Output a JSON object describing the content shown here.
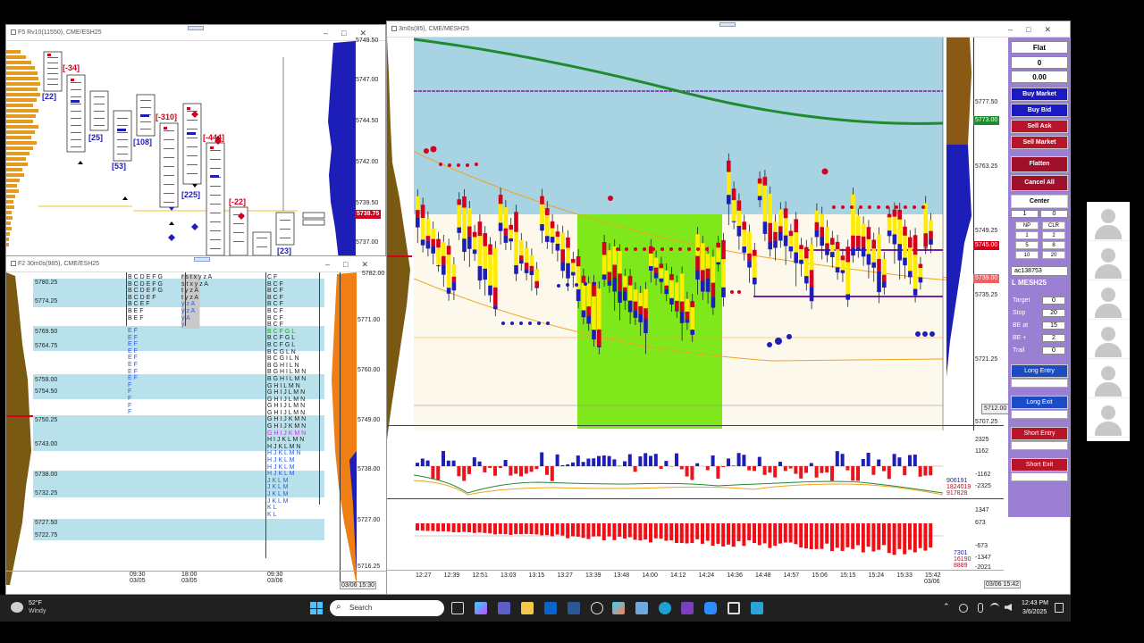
{
  "windows": {
    "topleft": {
      "title": "F5 Rv10(11550), CME/ESH25"
    },
    "bottomleft": {
      "title": "F2 30m0s(985), CME/ESH25"
    },
    "main": {
      "title": "3m0s(85), CME/MESH25"
    }
  },
  "topleft": {
    "axis": [
      "5749.50",
      "5747.00",
      "5744.50",
      "5742.00",
      "5739.50",
      "5737.00"
    ],
    "price_tag": "5738.75",
    "deltas": [
      "[-34]",
      "[22]",
      "[25]",
      "[53]",
      "[108]",
      "[-310]",
      "[225]",
      "[-444]",
      "[-22]",
      "[23]"
    ]
  },
  "bottomleft": {
    "axis": [
      "5782.00",
      "5771.00",
      "5760.00",
      "5749.00",
      "5738.00",
      "5727.00",
      "5716.25"
    ],
    "prices": [
      "5780.25",
      "5774.25",
      "5769.50",
      "5764.75",
      "5759.00",
      "5754.50",
      "5750.25",
      "5743.00",
      "5738.00",
      "5732.25",
      "5727.50",
      "5722.75"
    ],
    "dates": [
      {
        "t": "09:30",
        "d": "03/05"
      },
      {
        "t": "18:00",
        "d": "03/05"
      },
      {
        "t": "09:30",
        "d": "03/06"
      }
    ],
    "timestamp": "03/06 15:30",
    "tpo_col1": [
      "B C D E F G",
      "B C D E F G",
      "B C D E F G",
      "B C D E F",
      "B C E F",
      "B E F",
      "B E F"
    ],
    "tpo_col2": [
      "r s t x y z A",
      "s t x y z A",
      "t y z A",
      "t y z A",
      "y z A",
      "y z A",
      "y A",
      "y"
    ],
    "tpo_col3": [
      "C F",
      "B C F",
      "B C F",
      "B C F",
      "B C F",
      "B C F",
      "B C F",
      "B C F",
      "B C F G L",
      "B C F G L",
      "B C F G L",
      "B C G L N",
      "B C G I L N",
      "B G H I L N",
      "B G H I L M N",
      "B G H I L M N",
      "G H I L M N",
      "G H I J L M N",
      "G H I J L M N",
      "G H I J L M N",
      "G H I J L M N",
      "G H I J K M N",
      "G H I J K M N",
      "G H I J K M N",
      "H I J K L M N",
      "H J K L M N",
      "H J K L M N",
      "H J K L M",
      "H J K L M",
      "H J K L M",
      "J K L M",
      "J K L M",
      "J K L M",
      "J K L M",
      "K L",
      "K L"
    ]
  },
  "main": {
    "axis": [
      "5777.50",
      "5763.25",
      "5749.25",
      "5735.25",
      "5721.25",
      "5707.25"
    ],
    "tags": {
      "green": "5773.00",
      "red1": "5745.00",
      "red2": "5739.00",
      "gray": "5712.00"
    },
    "osc1_axis": [
      "2325",
      "1162",
      "-1162",
      "-2325"
    ],
    "osc1_values": [
      "906191",
      "1824019",
      "917828"
    ],
    "osc2_axis": [
      "2021",
      "1347",
      "673",
      "-673",
      "-1347",
      "-2021"
    ],
    "osc2_values": [
      "7301",
      "16190",
      "8889"
    ],
    "times": [
      "12:27",
      "12:39",
      "12:51",
      "13:03",
      "13:15",
      "13:27",
      "13:39",
      "13:48",
      "14:00",
      "14:12",
      "14:24",
      "14:36",
      "14:48",
      "14:57",
      "15:06",
      "15:15",
      "15:24",
      "15:33",
      "15:42"
    ],
    "end_date": "03/06",
    "end_stamp": "03/06 15:42"
  },
  "order_panel": {
    "status": "Flat",
    "position": "0",
    "pnl": "0.00",
    "buttons": [
      "Buy Market",
      "Buy Bid",
      "Sell Ask",
      "Sell Market",
      "Flatten",
      "Cancel All",
      "Center"
    ],
    "qty": "1",
    "qty2": "0",
    "grid": [
      [
        "NP",
        "CLR"
      ],
      [
        "1",
        "2"
      ],
      [
        "5",
        "8"
      ],
      [
        "10",
        "20"
      ]
    ],
    "account": "ac138753",
    "instrument": "L MESH25",
    "fields": [
      {
        "label": "Target",
        "value": "0"
      },
      {
        "label": "Stop",
        "value": "20"
      },
      {
        "label": "BE at",
        "value": "15"
      },
      {
        "label": "BE +",
        "value": "2"
      },
      {
        "label": "Trail",
        "value": "0"
      }
    ],
    "strategy": [
      "Long Entry",
      "Long Exit",
      "Short Entry",
      "Short Exit"
    ],
    "colors": {
      "panel": "#9b7fd3",
      "buy": "#1b19c4",
      "sell": "#b8142a",
      "flatten": "#a0102a",
      "strat_blue": "#1b4cc4",
      "strat_red": "#b8142a"
    }
  },
  "taskbar": {
    "temp": "52°F",
    "weather": "Windy",
    "search": "Search",
    "time": "12:43 PM",
    "date": "3/6/2025"
  }
}
